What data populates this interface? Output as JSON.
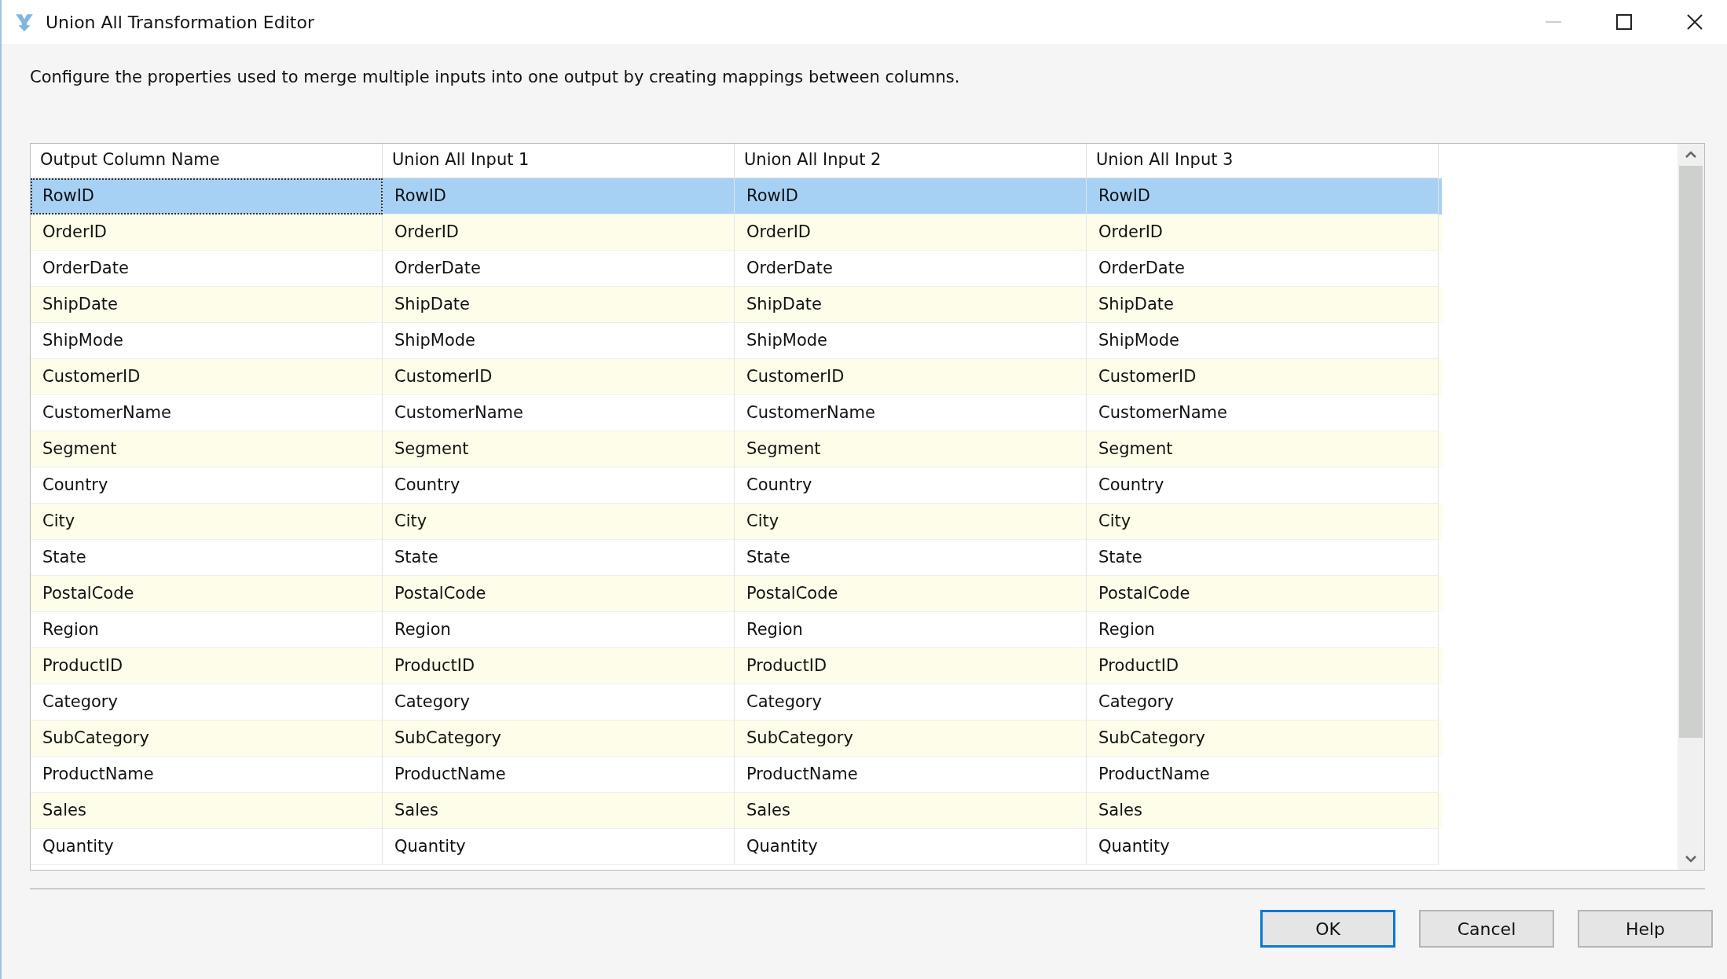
{
  "window": {
    "title": "Union All Transformation Editor"
  },
  "description": "Configure the properties used to merge multiple inputs into one output by creating mappings between columns.",
  "table": {
    "columns": [
      "Output Column Name",
      "Union All Input 1",
      "Union All Input 2",
      "Union All Input 3"
    ],
    "rows": [
      {
        "selected": true,
        "cells": [
          "RowID",
          "RowID",
          "RowID",
          "RowID"
        ]
      },
      {
        "selected": false,
        "cells": [
          "OrderID",
          "OrderID",
          "OrderID",
          "OrderID"
        ]
      },
      {
        "selected": false,
        "cells": [
          "OrderDate",
          "OrderDate",
          "OrderDate",
          "OrderDate"
        ]
      },
      {
        "selected": false,
        "cells": [
          "ShipDate",
          "ShipDate",
          "ShipDate",
          "ShipDate"
        ]
      },
      {
        "selected": false,
        "cells": [
          "ShipMode",
          "ShipMode",
          "ShipMode",
          "ShipMode"
        ]
      },
      {
        "selected": false,
        "cells": [
          "CustomerID",
          "CustomerID",
          "CustomerID",
          "CustomerID"
        ]
      },
      {
        "selected": false,
        "cells": [
          "CustomerName",
          "CustomerName",
          "CustomerName",
          "CustomerName"
        ]
      },
      {
        "selected": false,
        "cells": [
          "Segment",
          "Segment",
          "Segment",
          "Segment"
        ]
      },
      {
        "selected": false,
        "cells": [
          "Country",
          "Country",
          "Country",
          "Country"
        ]
      },
      {
        "selected": false,
        "cells": [
          "City",
          "City",
          "City",
          "City"
        ]
      },
      {
        "selected": false,
        "cells": [
          "State",
          "State",
          "State",
          "State"
        ]
      },
      {
        "selected": false,
        "cells": [
          "PostalCode",
          "PostalCode",
          "PostalCode",
          "PostalCode"
        ]
      },
      {
        "selected": false,
        "cells": [
          "Region",
          "Region",
          "Region",
          "Region"
        ]
      },
      {
        "selected": false,
        "cells": [
          "ProductID",
          "ProductID",
          "ProductID",
          "ProductID"
        ]
      },
      {
        "selected": false,
        "cells": [
          "Category",
          "Category",
          "Category",
          "Category"
        ]
      },
      {
        "selected": false,
        "cells": [
          "SubCategory",
          "SubCategory",
          "SubCategory",
          "SubCategory"
        ]
      },
      {
        "selected": false,
        "cells": [
          "ProductName",
          "ProductName",
          "ProductName",
          "ProductName"
        ]
      },
      {
        "selected": false,
        "cells": [
          "Sales",
          "Sales",
          "Sales",
          "Sales"
        ]
      },
      {
        "selected": false,
        "cells": [
          "Quantity",
          "Quantity",
          "Quantity",
          "Quantity"
        ]
      }
    ]
  },
  "buttons": [
    {
      "label": "OK",
      "default": true
    },
    {
      "label": "Cancel",
      "default": false
    },
    {
      "label": "Help",
      "default": false
    }
  ]
}
